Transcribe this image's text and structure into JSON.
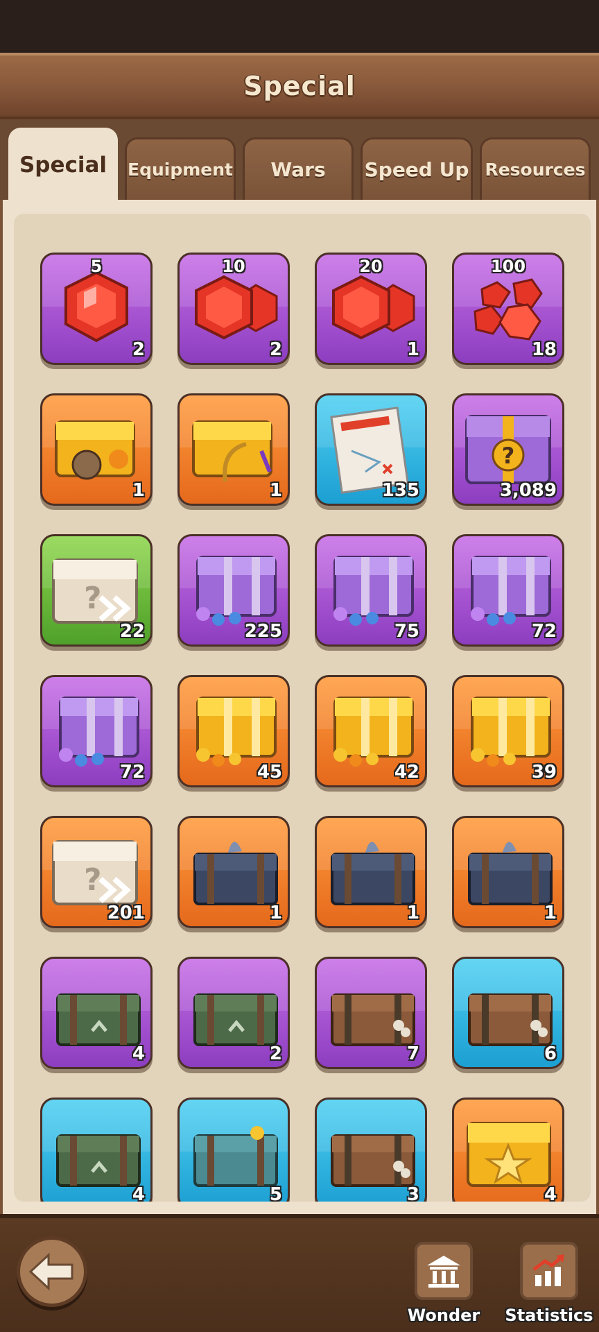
{
  "header": {
    "title": "Special"
  },
  "tabs": [
    {
      "label": "Special",
      "active": true
    },
    {
      "label": "Equipment",
      "active": false
    },
    {
      "label": "Wars",
      "active": false
    },
    {
      "label": "Speed Up",
      "active": false
    },
    {
      "label": "Resources",
      "active": false
    }
  ],
  "items": [
    {
      "name": "gem-5",
      "top_label": "5",
      "count": "2",
      "bg": "purple",
      "icon": "red-gem-icon"
    },
    {
      "name": "gem-10",
      "top_label": "10",
      "count": "2",
      "bg": "purple",
      "icon": "red-gems-icon"
    },
    {
      "name": "gem-20",
      "top_label": "20",
      "count": "1",
      "bg": "purple",
      "icon": "red-gems-icon"
    },
    {
      "name": "gem-100",
      "top_label": "100",
      "count": "18",
      "bg": "purple",
      "icon": "red-gem-pile-icon"
    },
    {
      "name": "artifact-chest",
      "top_label": "",
      "count": "1",
      "bg": "orange",
      "icon": "gold-chest-artifact-icon"
    },
    {
      "name": "relic-chest",
      "top_label": "",
      "count": "1",
      "bg": "orange",
      "icon": "gold-chest-harp-icon"
    },
    {
      "name": "confidential-map",
      "top_label": "",
      "count": "135",
      "bg": "blue",
      "icon": "confidential-map-icon"
    },
    {
      "name": "mystery-purple-chest",
      "top_label": "",
      "count": "3,089",
      "bg": "purple",
      "icon": "purple-mystery-chest-icon"
    },
    {
      "name": "mystery-speed-chest",
      "top_label": "",
      "count": "22",
      "bg": "green",
      "icon": "white-mystery-chest-icon"
    },
    {
      "name": "purple-puzzle-chest",
      "top_label": "",
      "count": "225",
      "bg": "purple",
      "icon": "purple-chest-icon"
    },
    {
      "name": "purple-part-chest-1",
      "top_label": "",
      "count": "75",
      "bg": "purple",
      "icon": "purple-chest-icon"
    },
    {
      "name": "purple-part-chest-2",
      "top_label": "",
      "count": "72",
      "bg": "purple",
      "icon": "purple-chest-icon"
    },
    {
      "name": "purple-part-chest-3",
      "top_label": "",
      "count": "72",
      "bg": "purple",
      "icon": "purple-chest-icon"
    },
    {
      "name": "gold-part-chest-1",
      "top_label": "",
      "count": "45",
      "bg": "orange",
      "icon": "gold-chest-icon"
    },
    {
      "name": "gold-part-chest-2",
      "top_label": "",
      "count": "42",
      "bg": "orange",
      "icon": "gold-chest-icon"
    },
    {
      "name": "gold-part-chest-3",
      "top_label": "",
      "count": "39",
      "bg": "orange",
      "icon": "gold-chest-icon"
    },
    {
      "name": "mystery-weapon-chest",
      "top_label": "",
      "count": "201",
      "bg": "orange",
      "icon": "white-mystery-chest-icon"
    },
    {
      "name": "jellyfish-chest",
      "top_label": "",
      "count": "1",
      "bg": "orange",
      "icon": "dark-chest-icon"
    },
    {
      "name": "coral-chest",
      "top_label": "",
      "count": "1",
      "bg": "orange",
      "icon": "dark-chest-icon"
    },
    {
      "name": "turtle-chest",
      "top_label": "",
      "count": "1",
      "bg": "orange",
      "icon": "dark-chest-icon"
    },
    {
      "name": "crab-chest",
      "top_label": "",
      "count": "4",
      "bg": "purple",
      "icon": "green-chest-icon"
    },
    {
      "name": "starfish-chest",
      "top_label": "",
      "count": "2",
      "bg": "purple",
      "icon": "green-chest-icon"
    },
    {
      "name": "octopus-chest",
      "top_label": "",
      "count": "7",
      "bg": "purple",
      "icon": "brown-chest-icon"
    },
    {
      "name": "barnacle-chest",
      "top_label": "",
      "count": "6",
      "bg": "blue",
      "icon": "brown-chest-icon"
    },
    {
      "name": "flower-chest",
      "top_label": "",
      "count": "4",
      "bg": "blue",
      "icon": "green-chest-icon"
    },
    {
      "name": "seaweed-chest",
      "top_label": "",
      "count": "5",
      "bg": "blue",
      "icon": "teal-chest-icon"
    },
    {
      "name": "rotten-chest",
      "top_label": "",
      "count": "3",
      "bg": "blue",
      "icon": "brown-chest-icon"
    },
    {
      "name": "star-gold-chest",
      "top_label": "",
      "count": "4",
      "bg": "orange",
      "icon": "gold-star-chest-icon"
    }
  ],
  "bottom_nav": {
    "back_icon": "back-arrow-icon",
    "wonder_label": "Wonder",
    "wonder_icon": "temple-icon",
    "statistics_label": "Statistics",
    "statistics_icon": "chart-up-icon"
  },
  "colors": {
    "purple": "#a855d4",
    "orange": "#f07f28",
    "blue": "#2fb6e2",
    "green": "#6cbd3b",
    "panel": "#eee2cf",
    "wood": "#87573a"
  }
}
